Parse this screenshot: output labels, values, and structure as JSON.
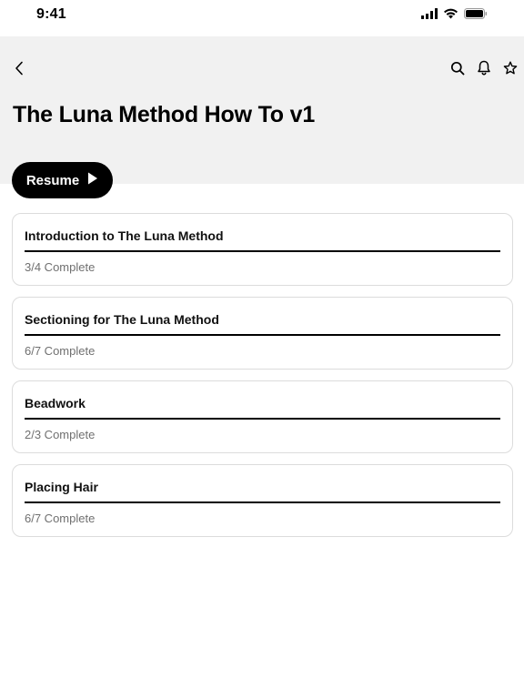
{
  "status_bar": {
    "time": "9:41"
  },
  "header": {
    "title": "The Luna Method How To v1",
    "back_icon": "chevron-left-icon",
    "actions": [
      "search-icon",
      "bell-icon",
      "star-icon"
    ]
  },
  "resume_button": {
    "label": "Resume",
    "icon": "play-icon"
  },
  "modules": [
    {
      "title": "Introduction to The Luna Method",
      "status": "3/4 Complete",
      "progress": 1.0
    },
    {
      "title": "Sectioning for The Luna Method",
      "status": "6/7 Complete",
      "progress": 1.0
    },
    {
      "title": "Beadwork",
      "status": "2/3 Complete",
      "progress": 1.0
    },
    {
      "title": "Placing Hair",
      "status": "6/7 Complete",
      "progress": 1.0
    }
  ],
  "colors": {
    "header_background": "#f1f1f1",
    "button_background": "#000000",
    "muted_text": "#707070",
    "card_border": "#dcdcdc"
  }
}
